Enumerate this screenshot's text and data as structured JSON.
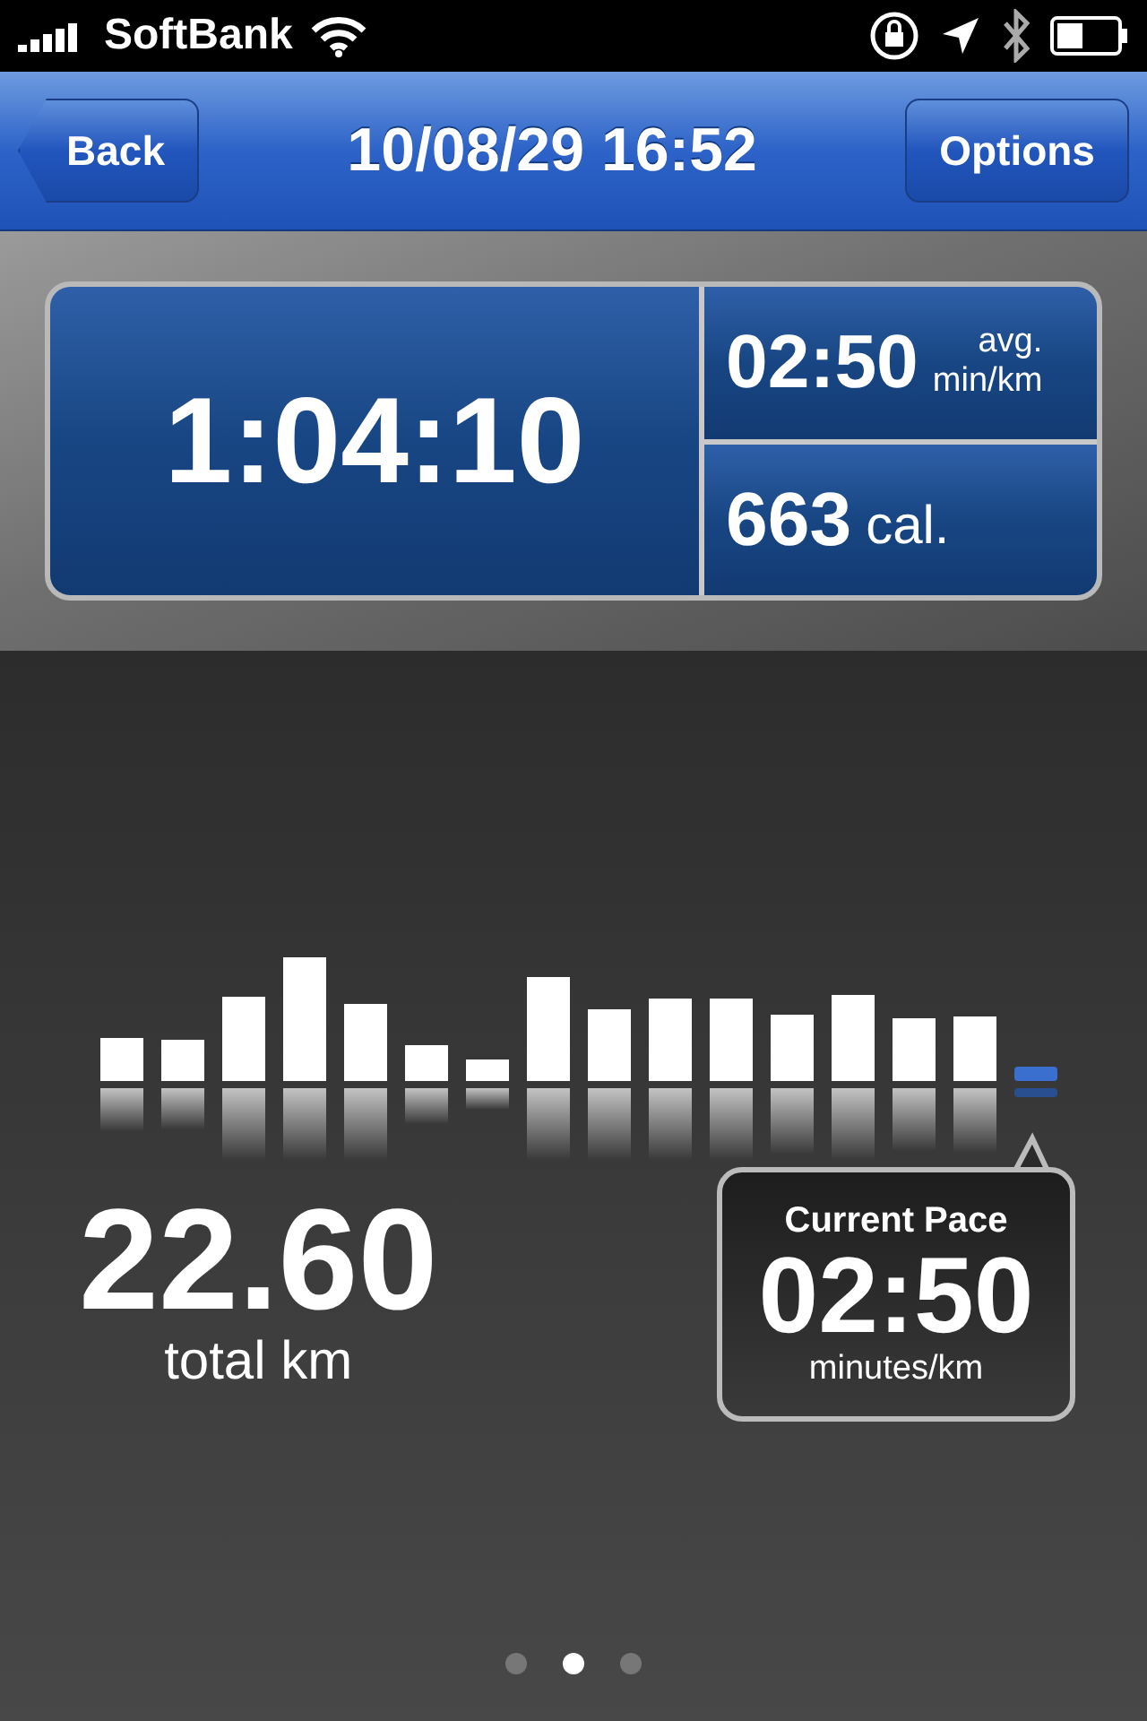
{
  "status_bar": {
    "carrier": "SoftBank"
  },
  "nav": {
    "back": "Back",
    "title": "10/08/29 16:52",
    "options": "Options"
  },
  "stats": {
    "duration": "1:04:10",
    "pace": "02:50",
    "pace_unit_1": "avg.",
    "pace_unit_2": "min/km",
    "calories": "663",
    "calories_unit": "cal."
  },
  "distance": {
    "value": "22.60",
    "unit": "total km"
  },
  "current_pace": {
    "label": "Current Pace",
    "value": "02:50",
    "unit": "minutes/km"
  },
  "pages": [
    {
      "selected": false
    },
    {
      "selected": true
    },
    {
      "selected": false
    }
  ]
}
